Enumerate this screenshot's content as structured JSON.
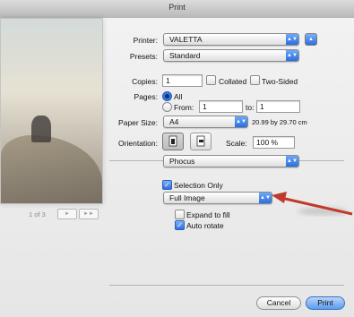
{
  "window": {
    "title": "Print"
  },
  "preview": {
    "page_label": "1 of 3",
    "next": "►",
    "last": "►►"
  },
  "printer": {
    "label": "Printer:",
    "value": "VALETTA"
  },
  "presets": {
    "label": "Presets:",
    "value": "Standard"
  },
  "copies": {
    "label": "Copies:",
    "value": "1",
    "collated": "Collated",
    "two_sided": "Two-Sided"
  },
  "pages": {
    "label": "Pages:",
    "all": "All",
    "from": "From:",
    "from_value": "1",
    "to": "to:",
    "to_value": "1"
  },
  "paper": {
    "label": "Paper Size:",
    "value": "A4",
    "dims": "20.99 by 29.70 cm"
  },
  "orientation": {
    "label": "Orientation:",
    "scale_label": "Scale:",
    "scale_value": "100 %"
  },
  "section": {
    "value": "Phocus"
  },
  "options": {
    "selection_only": "Selection Only",
    "image_mode": "Full Image",
    "expand": "Expand to fill",
    "auto_rotate": "Auto rotate",
    "selection_only_checked": true,
    "expand_checked": false,
    "auto_rotate_checked": true
  },
  "buttons": {
    "cancel": "Cancel",
    "print": "Print"
  },
  "colors": {
    "accent": "#2a6ee0",
    "arrow": "#c0392b"
  }
}
